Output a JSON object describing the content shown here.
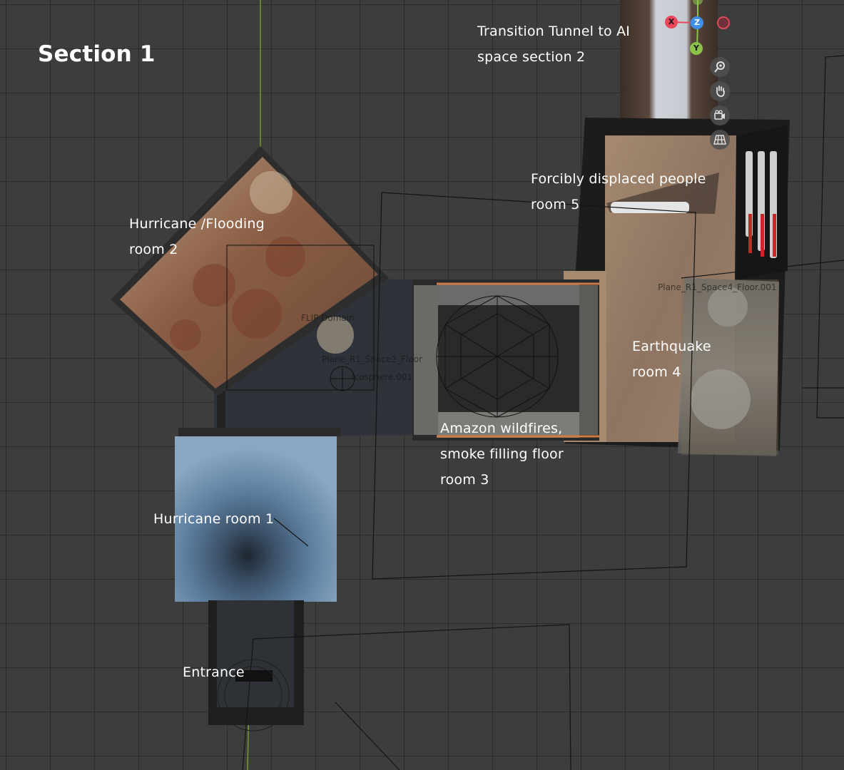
{
  "section_title": "Section 1",
  "annotations": {
    "transition_tunnel": "Transition Tunnel to AI\nspace section 2",
    "hurricane_flooding": "Hurricane /Flooding\nroom 2",
    "forcibly_displaced": "Forcibly displaced people\nroom 5",
    "earthquake": "Earthquake\nroom 4",
    "amazon_wildfires": "Amazon wildfires,\nsmoke filling floor\nroom 3",
    "hurricane_room_1": "Hurricane room 1",
    "entrance": "Entrance"
  },
  "scene_objects": {
    "flip_domain": "FLIP Domain",
    "plane_space2": "Plane_R1_Space2_Floor",
    "icosphere": "Icosphere.001",
    "plane_space4": "Plane_R1_Space4_Floor.001"
  },
  "gizmo": {
    "x_axis": "X",
    "y_axis": "Y",
    "z_axis": "Z",
    "colors": {
      "x": "#e8475c",
      "y": "#8bc34a",
      "z": "#3d8ee8"
    }
  },
  "nav_tools": [
    "zoom-icon",
    "pan-hand-icon",
    "camera-icon",
    "grid-view-icon"
  ]
}
